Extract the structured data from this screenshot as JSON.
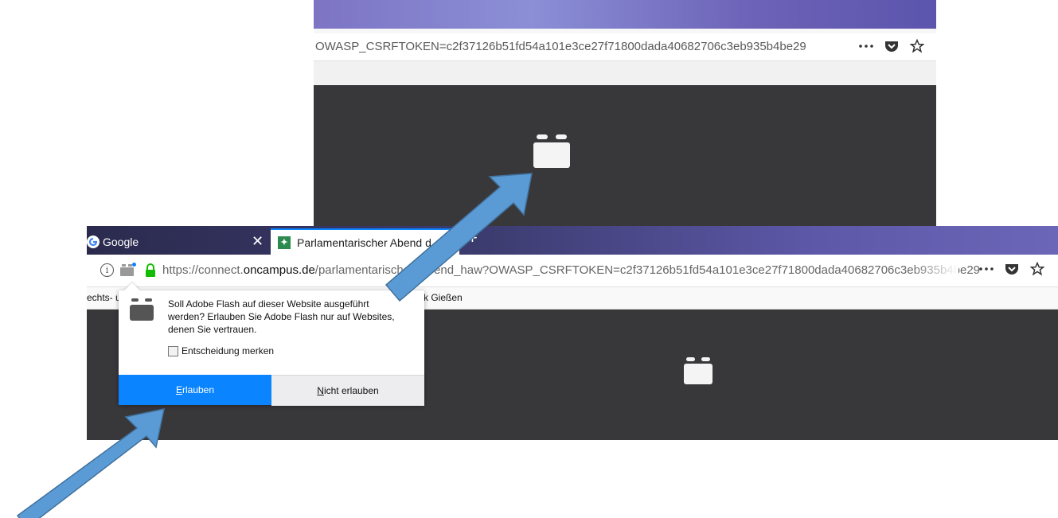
{
  "top_screenshot": {
    "url": "OWASP_CSRFTOKEN=c2f37126b51fd54a101e3ce27f71800dada40682706c3eb935b4be29",
    "icons": [
      "more-icon",
      "pocket-icon",
      "star-icon"
    ]
  },
  "bottom_screenshot": {
    "tabs": [
      {
        "label": "Google",
        "close": "✕"
      },
      {
        "label": "Parlamentarischer Abend d"
      }
    ],
    "new_tab": "+",
    "url": {
      "prefix": "https://connect.",
      "host": "oncampus.de",
      "path": "/parlamentarischer_abend_haw?OWASP_CSRFTOKEN=c2f37126b51fd54a101e3ce27f71800dada40682706c3eb935b4be29"
    },
    "bookmarks": {
      "left": "echts- u",
      "right": "k Gießen"
    }
  },
  "popup": {
    "message": "Soll Adobe Flash auf dieser Website ausgeführt werden? Erlauben Sie Adobe Flash nur auf Websites, denen Sie vertrauen.",
    "checkbox_label": "Entscheidung merken",
    "allow_label": "Erlauben",
    "deny_label": "Nicht erlauben"
  },
  "colors": {
    "content_bg": "#38373a",
    "allow_button": "#0a84ff",
    "annotation_arrow": "#5b9bd5"
  }
}
